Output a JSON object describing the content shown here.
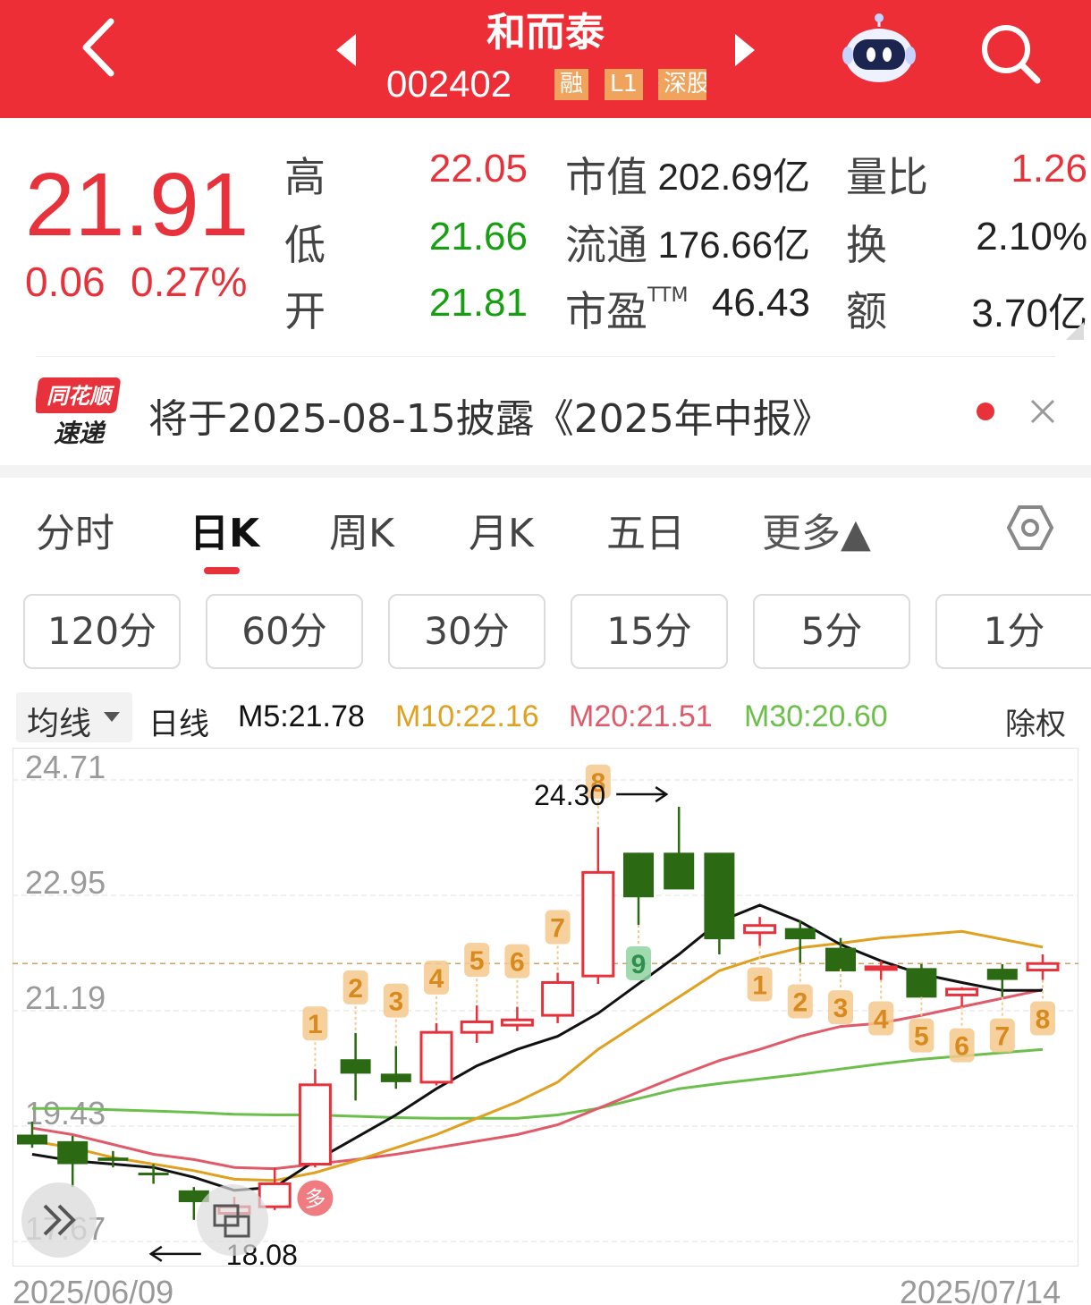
{
  "header": {
    "name": "和而泰",
    "code": "002402",
    "tags": [
      "融",
      "L1",
      "深股"
    ]
  },
  "quote": {
    "price": "21.91",
    "change": "0.06",
    "change_pct": "0.27%",
    "high_label": "高",
    "high": "22.05",
    "low_label": "低",
    "low": "21.66",
    "open_label": "开",
    "open": "21.81",
    "mktcap_label": "市值",
    "mktcap": "202.69亿",
    "float_label": "流通",
    "float": "176.66亿",
    "pe_label": "市盈",
    "pe_sup": "TTM",
    "pe": "46.43",
    "vol_ratio_label": "量比",
    "vol_ratio": "1.26",
    "turnover_label": "换",
    "turnover": "2.10%",
    "amount_label": "额",
    "amount": "3.70亿"
  },
  "notice": {
    "logo_top": "同花顺",
    "logo_bottom": "速递",
    "text": "将于2025-08-15披露《2025年中报》"
  },
  "tabs": [
    {
      "label": "分时"
    },
    {
      "label": "日K"
    },
    {
      "label": "周K"
    },
    {
      "label": "月K"
    },
    {
      "label": "五日"
    },
    {
      "label": "更多▲"
    }
  ],
  "periods": [
    "120分",
    "60分",
    "30分",
    "15分",
    "5分",
    "1分"
  ],
  "legend": {
    "ma_select": "均线",
    "kind": "日线",
    "m5": "M5:21.78",
    "m10": "M10:22.16",
    "m20": "M20:21.51",
    "m30": "M30:20.60",
    "adjust": "除权"
  },
  "colors": {
    "up": "#e8323b",
    "down": "#2b6a12",
    "m5": "#111111",
    "m10": "#e0a020",
    "m20": "#e05a6a",
    "m30": "#6cbf4a",
    "marker": "#f5c98c",
    "marker_green": "#8fd3a0"
  },
  "chart_data": {
    "type": "candlestick",
    "y_ticks": [
      "24.71",
      "22.95",
      "21.19",
      "19.43",
      "17.67"
    ],
    "ylim": [
      17.67,
      24.71
    ],
    "x_start": "2025/06/09",
    "x_end": "2025/07/14",
    "max_label": "24.30",
    "min_label": "18.08",
    "badge": "多",
    "candles": [
      {
        "o": 19.3,
        "h": 19.5,
        "l": 19.1,
        "c": 19.15
      },
      {
        "o": 19.2,
        "h": 19.28,
        "l": 18.5,
        "c": 18.85
      },
      {
        "o": 18.95,
        "h": 19.05,
        "l": 18.8,
        "c": 18.9
      },
      {
        "o": 18.72,
        "h": 18.85,
        "l": 18.55,
        "c": 18.68
      },
      {
        "o": 18.45,
        "h": 18.5,
        "l": 18.0,
        "c": 18.27
      },
      {
        "o": 18.1,
        "h": 18.35,
        "l": 18.08,
        "c": 18.2
      },
      {
        "o": 18.2,
        "h": 18.8,
        "l": 18.15,
        "c": 18.55
      },
      {
        "o": 18.85,
        "h": 20.3,
        "l": 18.8,
        "c": 20.06
      },
      {
        "o": 20.45,
        "h": 20.85,
        "l": 19.82,
        "c": 20.23
      },
      {
        "o": 20.23,
        "h": 20.65,
        "l": 20.0,
        "c": 20.1
      },
      {
        "o": 20.1,
        "h": 21.0,
        "l": 20.05,
        "c": 20.86
      },
      {
        "o": 20.86,
        "h": 21.27,
        "l": 20.7,
        "c": 21.02
      },
      {
        "o": 20.97,
        "h": 21.25,
        "l": 20.88,
        "c": 21.05
      },
      {
        "o": 21.12,
        "h": 21.77,
        "l": 21.0,
        "c": 21.62
      },
      {
        "o": 21.72,
        "h": 23.99,
        "l": 21.6,
        "c": 23.3
      },
      {
        "o": 23.6,
        "h": 23.6,
        "l": 22.5,
        "c": 22.92
      },
      {
        "o": 23.6,
        "h": 24.3,
        "l": 23.1,
        "c": 23.04
      },
      {
        "o": 23.6,
        "h": 23.6,
        "l": 22.05,
        "c": 22.28
      },
      {
        "o": 22.38,
        "h": 22.62,
        "l": 22.18,
        "c": 22.49
      },
      {
        "o": 22.45,
        "h": 22.57,
        "l": 21.92,
        "c": 22.28
      },
      {
        "o": 22.15,
        "h": 22.3,
        "l": 21.83,
        "c": 21.79
      },
      {
        "o": 21.86,
        "h": 21.95,
        "l": 21.66,
        "c": 21.86
      },
      {
        "o": 21.84,
        "h": 21.9,
        "l": 21.4,
        "c": 21.39
      },
      {
        "o": 21.43,
        "h": 21.55,
        "l": 21.25,
        "c": 21.52
      },
      {
        "o": 21.83,
        "h": 21.9,
        "l": 21.4,
        "c": 21.66
      },
      {
        "o": 21.81,
        "h": 22.05,
        "l": 21.66,
        "c": 21.91
      }
    ],
    "markers": [
      {
        "i": 7,
        "t": "1",
        "pos": "above"
      },
      {
        "i": 8,
        "t": "2",
        "pos": "above"
      },
      {
        "i": 9,
        "t": "3",
        "pos": "above"
      },
      {
        "i": 10,
        "t": "4",
        "pos": "above"
      },
      {
        "i": 11,
        "t": "5",
        "pos": "above"
      },
      {
        "i": 12,
        "t": "6",
        "pos": "above"
      },
      {
        "i": 13,
        "t": "7",
        "pos": "above"
      },
      {
        "i": 14,
        "t": "8",
        "pos": "above"
      },
      {
        "i": 15,
        "t": "9",
        "pos": "below",
        "green": true
      },
      {
        "i": 18,
        "t": "1",
        "pos": "below"
      },
      {
        "i": 19,
        "t": "2",
        "pos": "below"
      },
      {
        "i": 20,
        "t": "3",
        "pos": "below"
      },
      {
        "i": 21,
        "t": "4",
        "pos": "below"
      },
      {
        "i": 22,
        "t": "5",
        "pos": "below"
      },
      {
        "i": 23,
        "t": "6",
        "pos": "below"
      },
      {
        "i": 24,
        "t": "7",
        "pos": "below"
      },
      {
        "i": 25,
        "t": "8",
        "pos": "below"
      }
    ],
    "ma": {
      "m5": [
        19.0,
        18.9,
        18.85,
        18.8,
        18.65,
        18.45,
        18.5,
        18.9,
        19.25,
        19.6,
        20.0,
        20.35,
        20.6,
        20.8,
        21.15,
        21.6,
        22.05,
        22.55,
        22.8,
        22.55,
        22.2,
        21.95,
        21.75,
        21.62,
        21.5,
        21.5
      ],
      "m10": [
        19.2,
        19.1,
        18.95,
        18.85,
        18.75,
        18.62,
        18.6,
        18.72,
        18.9,
        19.1,
        19.3,
        19.55,
        19.8,
        20.1,
        20.6,
        21.0,
        21.4,
        21.8,
        22.0,
        22.15,
        22.22,
        22.3,
        22.35,
        22.4,
        22.28,
        22.16
      ],
      "m20": [
        19.4,
        19.3,
        19.15,
        19.0,
        18.92,
        18.8,
        18.78,
        18.85,
        18.92,
        19.0,
        19.1,
        19.2,
        19.3,
        19.45,
        19.7,
        19.95,
        20.2,
        20.43,
        20.6,
        20.8,
        20.95,
        21.0,
        21.12,
        21.25,
        21.38,
        21.51
      ],
      "m30": [
        19.7,
        19.7,
        19.68,
        19.66,
        19.64,
        19.61,
        19.6,
        19.6,
        19.58,
        19.56,
        19.55,
        19.55,
        19.55,
        19.6,
        19.7,
        19.85,
        20.0,
        20.08,
        20.15,
        20.22,
        20.3,
        20.38,
        20.45,
        20.5,
        20.55,
        20.6
      ]
    }
  }
}
